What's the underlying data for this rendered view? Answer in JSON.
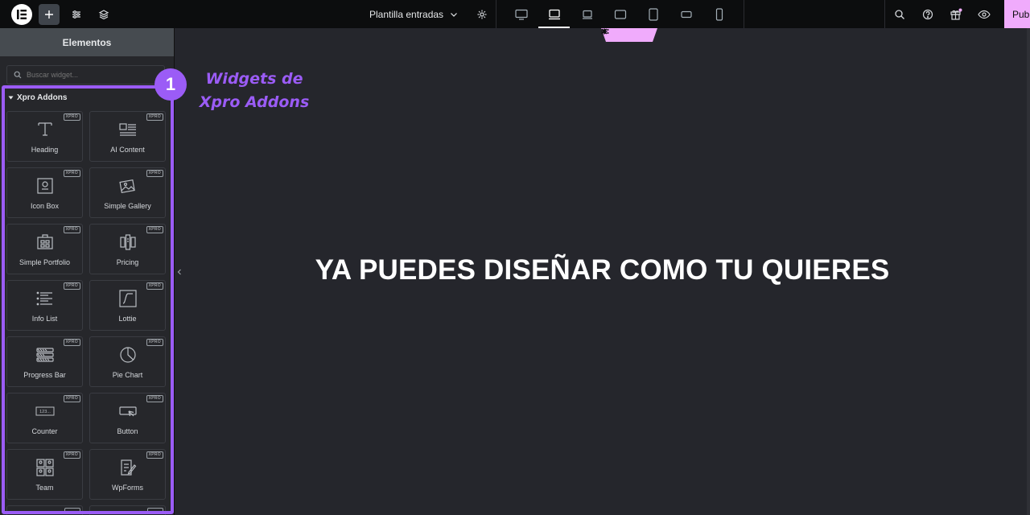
{
  "topbar": {
    "page_selector": "Plantilla entradas",
    "publish_label": "Publicar",
    "devices": [
      "desktop",
      "laptop-active",
      "laptop",
      "tablet-landscape",
      "tablet",
      "mobile-landscape",
      "mobile"
    ]
  },
  "panel": {
    "title": "Elementos",
    "search_placeholder": "Buscar widget...",
    "category": "Xpro Addons",
    "badge": "XPRO",
    "widgets": [
      {
        "label": "Heading",
        "icon": "heading-icon"
      },
      {
        "label": "AI Content",
        "icon": "ai-content-icon"
      },
      {
        "label": "Icon Box",
        "icon": "icon-box-icon"
      },
      {
        "label": "Simple Gallery",
        "icon": "gallery-icon"
      },
      {
        "label": "Simple Portfolio",
        "icon": "portfolio-icon"
      },
      {
        "label": "Pricing",
        "icon": "pricing-icon"
      },
      {
        "label": "Info List",
        "icon": "info-list-icon"
      },
      {
        "label": "Lottie",
        "icon": "lottie-icon"
      },
      {
        "label": "Progress Bar",
        "icon": "progress-bar-icon"
      },
      {
        "label": "Pie Chart",
        "icon": "pie-chart-icon"
      },
      {
        "label": "Counter",
        "icon": "counter-icon"
      },
      {
        "label": "Button",
        "icon": "button-icon"
      },
      {
        "label": "Team",
        "icon": "team-icon"
      },
      {
        "label": "WpForms",
        "icon": "wpforms-icon"
      }
    ]
  },
  "annotation": {
    "number": "1",
    "text_line1": "Widgets de",
    "text_line2": "Xpro Addons"
  },
  "canvas": {
    "heading": "YA PUEDES DISEÑAR COMO TU QUIERES"
  },
  "colors": {
    "accent": "#9b5cf6",
    "publish": "#f0abfc",
    "canvas_bg": "#25262c"
  }
}
